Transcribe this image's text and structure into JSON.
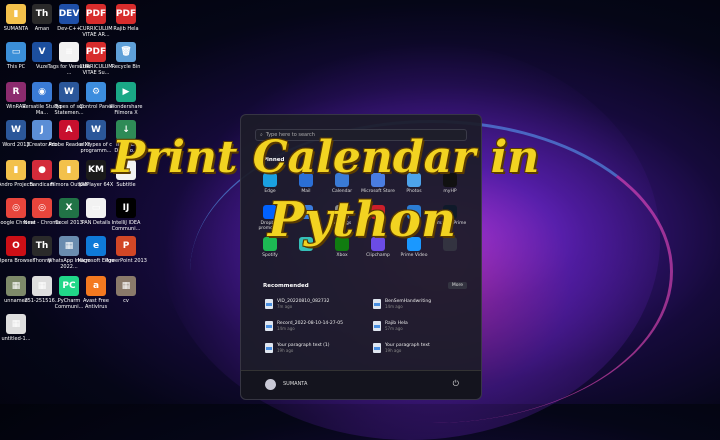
{
  "desktop_icons": [
    {
      "label": "SUMANTA",
      "color": "#f3c14b",
      "glyph": "▮"
    },
    {
      "label": "Aman",
      "color": "#2a2a2a",
      "glyph": "Th"
    },
    {
      "label": "Dev-C++",
      "color": "#1e4fa8",
      "glyph": "DEV"
    },
    {
      "label": "CURRICULUM VITAE AR...",
      "color": "#d72c2c",
      "glyph": "PDF"
    },
    {
      "label": "Rajib Hela",
      "color": "#d72c2c",
      "glyph": "PDF"
    },
    {
      "label": "This PC",
      "color": "#3b8fd8",
      "glyph": "▭"
    },
    {
      "label": "Vuze",
      "color": "#1c4f9e",
      "glyph": "V"
    },
    {
      "label": "Tags for Versatile ...",
      "color": "#f2f2f2",
      "glyph": "≡"
    },
    {
      "label": "CURRICULUM VITAE Su...",
      "color": "#d72c2c",
      "glyph": "PDF"
    },
    {
      "label": "Recycle Bin",
      "color": "#5fa0d8",
      "glyph": "🗑"
    },
    {
      "label": "WinRAR",
      "color": "#8c2b6e",
      "glyph": "R"
    },
    {
      "label": "Versatile Studio Ma...",
      "color": "#3a7bd5",
      "glyph": "◉"
    },
    {
      "label": "Types of sql Statemen...",
      "color": "#2b579a",
      "glyph": "W"
    },
    {
      "label": "Control Panel",
      "color": "#3c8dde",
      "glyph": "⚙"
    },
    {
      "label": "Wondershare Filmora X",
      "color": "#1aa886",
      "glyph": "▶"
    },
    {
      "label": "Word 2013",
      "color": "#2b579a",
      "glyph": "W"
    },
    {
      "label": "JCreator Pro",
      "color": "#5b8ed6",
      "glyph": "J"
    },
    {
      "label": "Adobe Reader XI",
      "color": "#c8102e",
      "glyph": "A"
    },
    {
      "label": "all types of c programm...",
      "color": "#2b579a",
      "glyph": "W"
    },
    {
      "label": "Internet Downlo...",
      "color": "#2e8b57",
      "glyph": "↓"
    },
    {
      "label": "Andro Projects",
      "color": "#f3c14b",
      "glyph": "▮"
    },
    {
      "label": "Bandicam",
      "color": "#d42b3a",
      "glyph": "●"
    },
    {
      "label": "Filmora Output",
      "color": "#f3c14b",
      "glyph": "▮"
    },
    {
      "label": "KMPlayer 64X",
      "color": "#1a1a1a",
      "glyph": "KM"
    },
    {
      "label": "Subtitle",
      "color": "#f2f2f2",
      "glyph": "≡"
    },
    {
      "label": "Google Chrome",
      "color": "#e8453c",
      "glyph": "◎"
    },
    {
      "label": "Neat - Chrome",
      "color": "#e8453c",
      "glyph": "◎"
    },
    {
      "label": "Excel 2013",
      "color": "#217346",
      "glyph": "X"
    },
    {
      "label": "PAN Details",
      "color": "#f2f2f2",
      "glyph": "▭"
    },
    {
      "label": "IntelliJ IDEA Communi...",
      "color": "#000000",
      "glyph": "IJ"
    },
    {
      "label": "Opera Browser",
      "color": "#cc0f16",
      "glyph": "O"
    },
    {
      "label": "Thonny",
      "color": "#2a2a2a",
      "glyph": "Th"
    },
    {
      "label": "WhatsApp Image 2022...",
      "color": "#6a8caf",
      "glyph": "▦"
    },
    {
      "label": "Microsoft Edge",
      "color": "#0f7ad8",
      "glyph": "e"
    },
    {
      "label": "PowerPoint 2013",
      "color": "#d24726",
      "glyph": "P"
    },
    {
      "label": "unnamed",
      "color": "#7e8a6a",
      "glyph": "▦"
    },
    {
      "label": "251-251516...",
      "color": "#dedede",
      "glyph": "▦"
    },
    {
      "label": "PyCharm Communi...",
      "color": "#21d789",
      "glyph": "PC"
    },
    {
      "label": "Avast Free Antivirus",
      "color": "#f47920",
      "glyph": "a"
    },
    {
      "label": "cv",
      "color": "#8a7a6a",
      "glyph": "▦"
    },
    {
      "label": "untitled-1...",
      "color": "#dedede",
      "glyph": "▦"
    }
  ],
  "start_menu": {
    "search_placeholder": "Type here to search",
    "pinned_title": "Pinned",
    "pinned": [
      {
        "label": "Edge",
        "color": "#1aa0e0"
      },
      {
        "label": "Mail",
        "color": "#2b6fd6"
      },
      {
        "label": "Calendar",
        "color": "#3a7bd5"
      },
      {
        "label": "Microsoft Store",
        "color": "#4a7de0"
      },
      {
        "label": "Photos",
        "color": "#4da3ea"
      },
      {
        "label": "myHP",
        "color": "#111111"
      },
      {
        "label": "Dropbox promotion",
        "color": "#0061fe"
      },
      {
        "label": "",
        "color": "#3b7ddd"
      },
      {
        "label": "Settings",
        "color": "#8a8a8a"
      },
      {
        "label": "",
        "color": "#cc1f2a"
      },
      {
        "label": "",
        "color": "#2b7cd3"
      },
      {
        "label": "Amazon Prime",
        "color": "#0f1a2a"
      },
      {
        "label": "Spotify",
        "color": "#1db954"
      },
      {
        "label": "",
        "color": "#35c0b8"
      },
      {
        "label": "Xbox",
        "color": "#107c10"
      },
      {
        "label": "Clipchamp",
        "color": "#6b4ce6"
      },
      {
        "label": "Prime Video",
        "color": "#1a98ff"
      },
      {
        "label": "",
        "color": "#333340"
      }
    ],
    "recommended_title": "Recommended",
    "more_label": "More",
    "recommended": [
      {
        "name": "VID_20220810_082732",
        "time": "7m ago"
      },
      {
        "name": "BenSemHandwriting",
        "time": "14m ago"
      },
      {
        "name": "Record_2022-08-10-14-27-05",
        "time": "14m ago"
      },
      {
        "name": "Rajib Hela",
        "time": "57m ago"
      },
      {
        "name": "Your paragraph text (1)",
        "time": "19h ago"
      },
      {
        "name": "Your paragraph text",
        "time": "19h ago"
      }
    ],
    "user_name": "SUMANTA"
  },
  "overlay": {
    "line1": "Print Calendar in",
    "line2": "Python",
    "color": "#f2d321"
  }
}
